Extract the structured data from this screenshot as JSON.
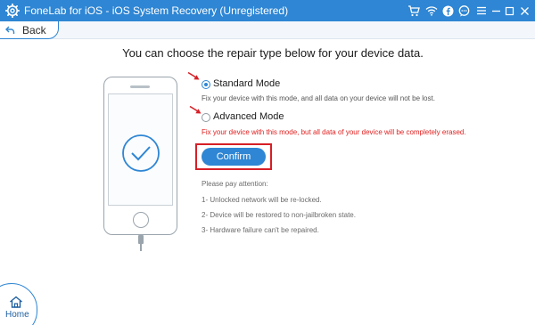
{
  "window": {
    "title": "FoneLab for iOS - iOS System Recovery (Unregistered)",
    "accent_color": "#2e86d4",
    "highlight_color": "#d61f26",
    "titlebar_icons": [
      "cart-icon",
      "wifi-icon",
      "facebook-icon",
      "chat-icon",
      "menu-icon",
      "minimize-icon",
      "restore-icon",
      "close-icon"
    ]
  },
  "nav": {
    "back_label": "Back",
    "home_label": "Home"
  },
  "main": {
    "heading": "You can choose the repair type below for your device data.",
    "options": [
      {
        "label": "Standard Mode",
        "selected": true,
        "description": "Fix your device with this mode, and all data on your device will not be lost.",
        "description_color": "#555555"
      },
      {
        "label": "Advanced Mode",
        "selected": false,
        "description": "Fix your device with this mode, but all data of your device will be completely erased.",
        "description_color": "#e02020"
      }
    ],
    "confirm_label": "Confirm",
    "notes_title": "Please pay attention:",
    "notes": [
      "1- Unlocked network will be re-locked.",
      "2- Device will be restored to non-jailbroken state.",
      "3- Hardware failure can't be repaired."
    ]
  }
}
